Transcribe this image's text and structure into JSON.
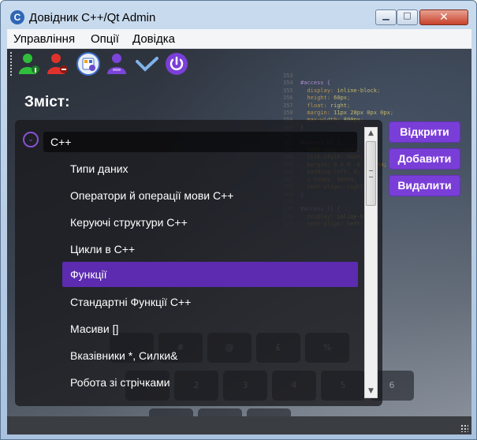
{
  "window": {
    "title": "Довідник C++/Qt Admin",
    "controls": {
      "minimize": "▁",
      "maximize": "□",
      "close": "✕"
    },
    "app_icon": "C"
  },
  "menubar": {
    "items": [
      "Управління",
      "Опції",
      "Довідка"
    ]
  },
  "toolbar": {
    "icons": [
      "user-green-icon",
      "user-red-icon",
      "settings-panel-icon",
      "user-purple-icon",
      "checkmark-icon",
      "power-icon"
    ]
  },
  "content": {
    "heading": "Зміст:",
    "tree": {
      "root_label": "C++",
      "expander_glyph": "⌄",
      "items": [
        "Типи даних",
        "Оператори й операції мови C++",
        "Керуючі структури C++",
        "Цикли в C++",
        "Функції",
        "Стандартні Функції C++",
        "Масиви []",
        "Вказівники *, Силки&",
        "Робота зі стрічками"
      ],
      "selected_index": 4
    },
    "buttons": {
      "open": "Відкрити",
      "add": "Добавити",
      "delete": "Видалити"
    }
  },
  "colors": {
    "accent": "#7a3ed8",
    "selection": "#5c2bb0",
    "titlebar": "#c9dbee"
  }
}
